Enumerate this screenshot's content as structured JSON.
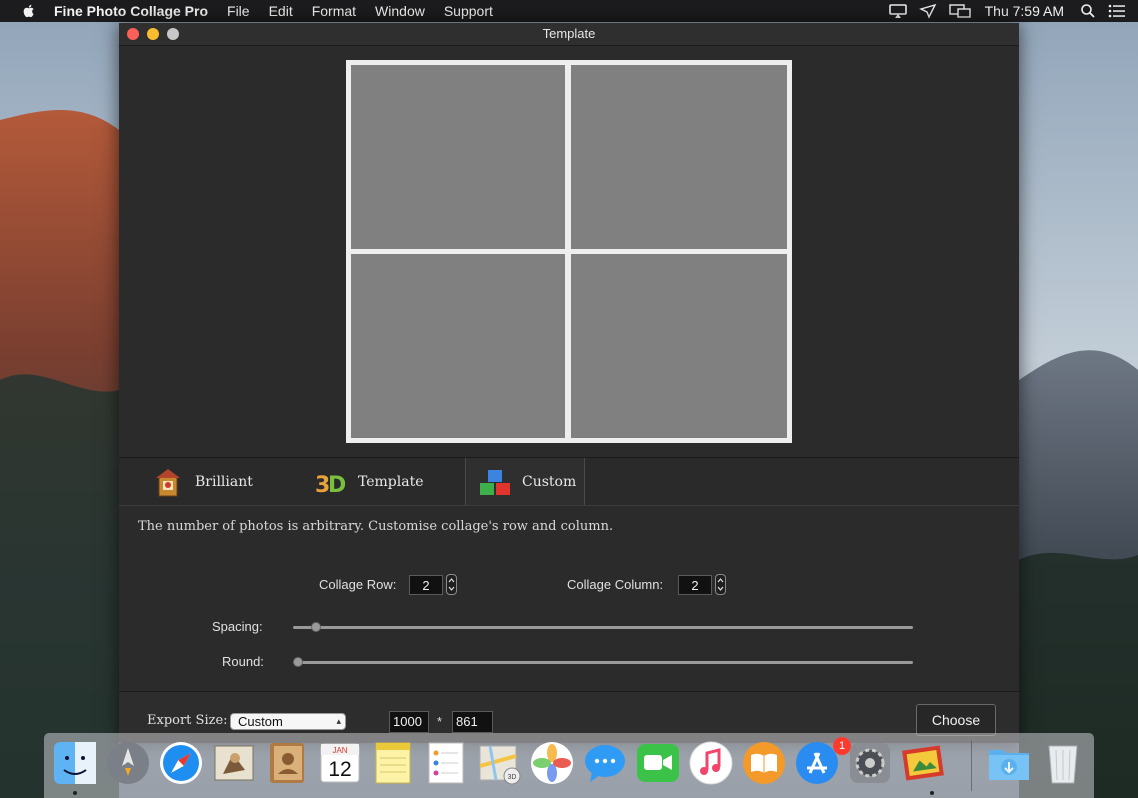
{
  "menubar": {
    "app_name": "Fine Photo Collage Pro",
    "menus": [
      "File",
      "Edit",
      "Format",
      "Window",
      "Support"
    ],
    "clock": "Thu 7:59 AM"
  },
  "window": {
    "title": "Template",
    "tabs": [
      {
        "label": "Brilliant",
        "icon": "brilliant-icon"
      },
      {
        "label": "Template",
        "icon": "3d-template-icon"
      },
      {
        "label": "Custom",
        "icon": "custom-blocks-icon",
        "active": true
      }
    ],
    "description": "The number of photos is arbitrary. Customise collage's row and column.",
    "row_label": "Collage Row:",
    "row_value": "2",
    "column_label": "Collage Column:",
    "column_value": "2",
    "spacing_label": "Spacing:",
    "spacing_value": 0.03,
    "round_label": "Round:",
    "round_value": 0.0,
    "export_label": "Export Size:",
    "export_option": "Custom",
    "export_width": "1000",
    "export_sep": "*",
    "export_height": "861",
    "choose_label": "Choose"
  },
  "dock": {
    "apps": [
      "Finder",
      "Launchpad",
      "Safari",
      "Mail",
      "Contacts",
      "Calendar",
      "Notes",
      "Reminders",
      "Maps",
      "Photos",
      "Messages",
      "FaceTime",
      "iTunes",
      "iBooks",
      "App Store",
      "System Preferences",
      "Fine Photo Collage Pro",
      "Downloads",
      "Trash"
    ],
    "calendar_month": "JAN",
    "calendar_day": "12",
    "app_store_badge": "1"
  },
  "colors": {
    "window_bg": "#2b2b2b",
    "cell_gray": "#808080",
    "frame": "#eeeeee"
  }
}
